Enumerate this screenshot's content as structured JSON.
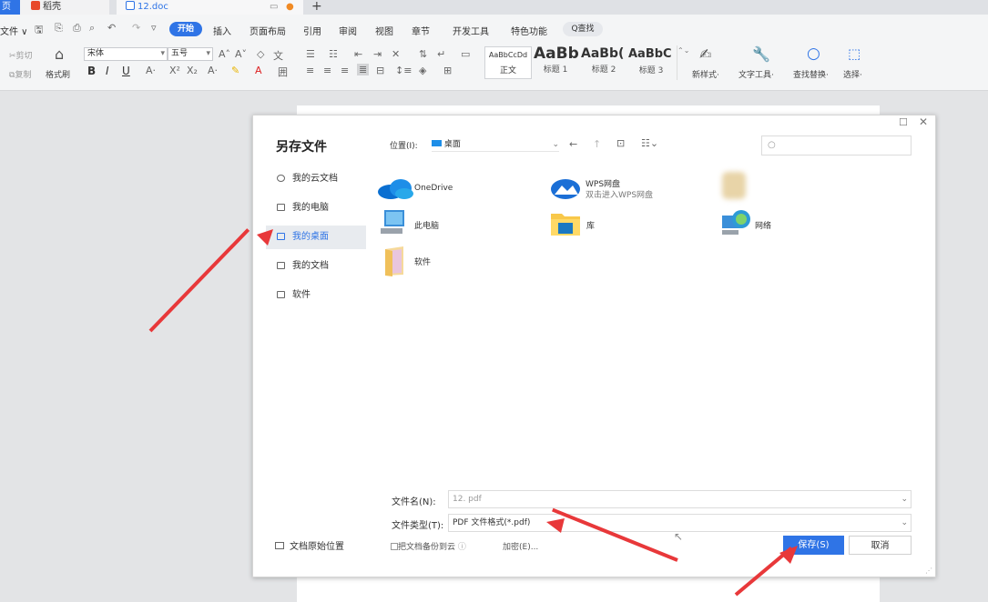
{
  "tabs": {
    "home": "页",
    "daoke": "稻壳",
    "doc": "12.doc",
    "new_tab": "+"
  },
  "menu": {
    "file": "文件 ∨",
    "start": "开始",
    "items": [
      "插入",
      "页面布局",
      "引用",
      "审阅",
      "视图",
      "章节",
      "开发工具",
      "特色功能"
    ],
    "search": "Q查找"
  },
  "ribbon": {
    "cut": "剪切",
    "copy": "复制",
    "format_painter": "格式刷",
    "font": "宋体",
    "size": "五号",
    "styles": [
      {
        "preview": "AaBbCcDd",
        "name": "正文"
      },
      {
        "preview": "AaBb",
        "name": "标题 1"
      },
      {
        "preview": "AaBb(",
        "name": "标题 2"
      },
      {
        "preview": "AaBbC",
        "name": "标题 3"
      }
    ],
    "new_style": "新样式·",
    "text_tools": "文字工具·",
    "find_replace": "查找替换·",
    "select": "选择·"
  },
  "dialog": {
    "title": "另存文件",
    "location_label": "位置(I):",
    "location_value": "桌面",
    "sidebar": [
      "我的云文档",
      "我的电脑",
      "我的桌面",
      "我的文档",
      "软件"
    ],
    "selected_sidebar_index": 2,
    "files": [
      {
        "name": "OneDrive",
        "sub": ""
      },
      {
        "name": "WPS网盘",
        "sub": "双击进入WPS网盘"
      },
      {
        "name": "此电脑",
        "sub": ""
      },
      {
        "name": "库",
        "sub": ""
      },
      {
        "name": "网络",
        "sub": ""
      },
      {
        "name": "软件",
        "sub": ""
      }
    ],
    "filename_label": "文件名(N):",
    "filename_value": "12. pdf",
    "filetype_label": "文件类型(T):",
    "filetype_value": "PDF 文件格式(*.pdf)",
    "backup_label": "把文档备份到云",
    "encrypt_label": "加密(E)...",
    "original_location": "文档原始位置",
    "save": "保存(S)",
    "cancel": "取消"
  },
  "colors": {
    "accent": "#2f74e6",
    "arrow": "#e8383a"
  }
}
